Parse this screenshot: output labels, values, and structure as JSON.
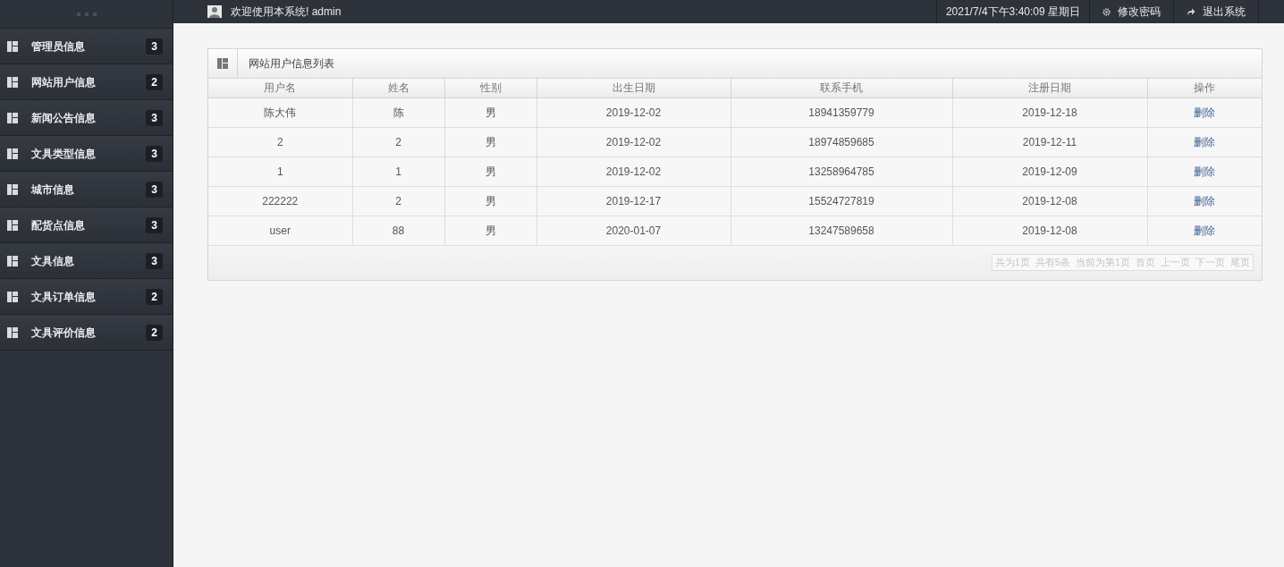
{
  "sidebar": {
    "items": [
      {
        "label": "管理员信息",
        "count": "3"
      },
      {
        "label": "网站用户信息",
        "count": "2"
      },
      {
        "label": "新闻公告信息",
        "count": "3"
      },
      {
        "label": "文具类型信息",
        "count": "3"
      },
      {
        "label": "城市信息",
        "count": "3"
      },
      {
        "label": "配货点信息",
        "count": "3"
      },
      {
        "label": "文具信息",
        "count": "3"
      },
      {
        "label": "文具订单信息",
        "count": "2"
      },
      {
        "label": "文具评价信息",
        "count": "2"
      }
    ]
  },
  "header": {
    "welcome": "欢迎使用本系统! admin",
    "datetime": "2021/7/4下午3:40:09 星期日",
    "actions": [
      {
        "label": "修改密码",
        "kind": "password"
      },
      {
        "label": "退出系统",
        "kind": "logout"
      }
    ]
  },
  "panel": {
    "title": "网站用户信息列表",
    "table": {
      "columns": [
        "用户名",
        "姓名",
        "性别",
        "出生日期",
        "联系手机",
        "注册日期",
        "操作"
      ],
      "rows": [
        [
          "陈大伟",
          "陈",
          "男",
          "2019-12-02",
          "18941359779",
          "2019-12-18",
          "删除"
        ],
        [
          "2",
          "2",
          "男",
          "2019-12-02",
          "18974859685",
          "2019-12-11",
          "删除"
        ],
        [
          "1",
          "1",
          "男",
          "2019-12-02",
          "13258964785",
          "2019-12-09",
          "删除"
        ],
        [
          "222222",
          "2",
          "男",
          "2019-12-17",
          "15524727819",
          "2019-12-08",
          "删除"
        ],
        [
          "user",
          "88",
          "男",
          "2020-01-07",
          "13247589658",
          "2019-12-08",
          "删除"
        ]
      ]
    },
    "pagination": [
      "共为1页",
      "共有5条",
      "当前为第1页",
      "首页",
      "上一页",
      "下一页",
      "尾页"
    ]
  }
}
